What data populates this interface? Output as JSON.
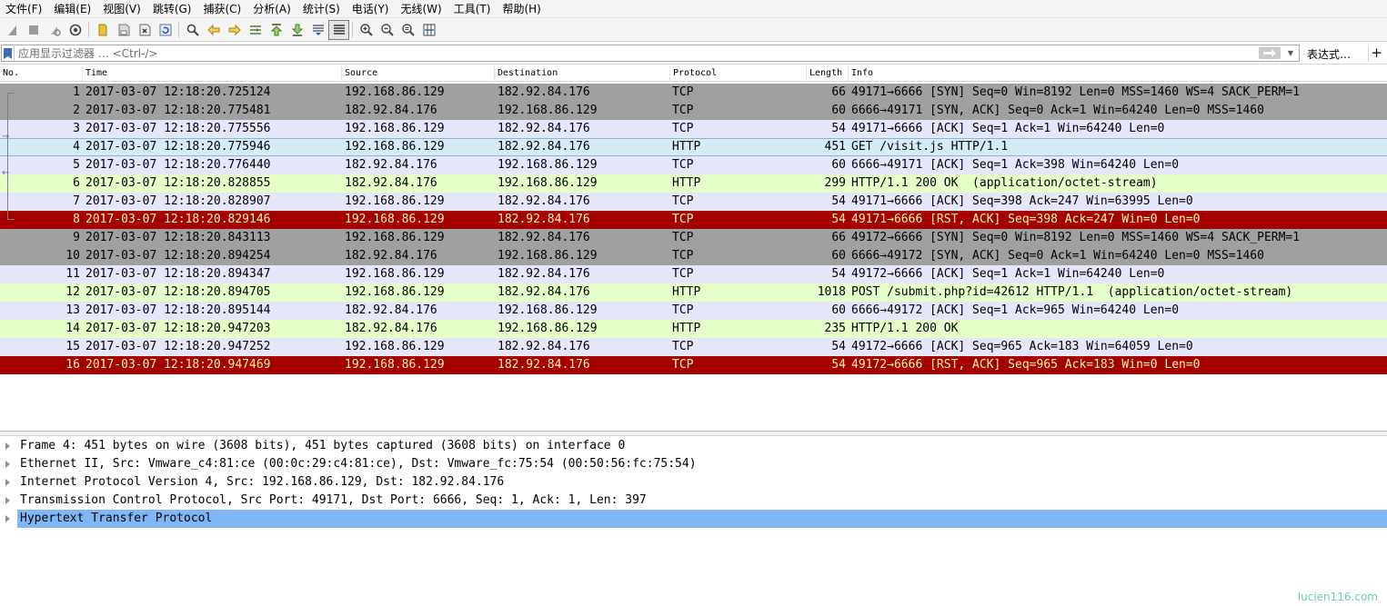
{
  "menu": [
    "文件(F)",
    "编辑(E)",
    "视图(V)",
    "跳转(G)",
    "捕获(C)",
    "分析(A)",
    "统计(S)",
    "电话(Y)",
    "无线(W)",
    "工具(T)",
    "帮助(H)"
  ],
  "toolbar": {
    "icons": [
      "shark-fin-start-icon",
      "stop-icon",
      "restart-icon",
      "capture-options-icon",
      "open-file-icon",
      "save-file-icon",
      "close-file-icon",
      "reload-icon",
      "find-packet-icon",
      "go-back-icon",
      "go-forward-icon",
      "go-to-packet-icon",
      "go-first-icon",
      "go-last-icon",
      "auto-scroll-icon",
      "colorize-icon",
      "zoom-in-icon",
      "zoom-out-icon",
      "zoom-normal-icon",
      "resize-columns-icon"
    ]
  },
  "filter": {
    "placeholder": "应用显示过滤器 … <Ctrl-/>",
    "expression_label": "表达式…",
    "add_label": "+"
  },
  "columns": {
    "no": "No.",
    "time": "Time",
    "source": "Source",
    "destination": "Destination",
    "protocol": "Protocol",
    "length": "Length",
    "info": "Info"
  },
  "packets": [
    {
      "no": "1",
      "time": "2017-03-07 12:18:20.725124",
      "src": "192.168.86.129",
      "dst": "182.92.84.176",
      "proto": "TCP",
      "len": "66",
      "info": "49171→6666 [SYN] Seq=0 Win=8192 Len=0 MSS=1460 WS=4 SACK_PERM=1",
      "style": "gray"
    },
    {
      "no": "2",
      "time": "2017-03-07 12:18:20.775481",
      "src": "182.92.84.176",
      "dst": "192.168.86.129",
      "proto": "TCP",
      "len": "60",
      "info": "6666→49171 [SYN, ACK] Seq=0 Ack=1 Win=64240 Len=0 MSS=1460",
      "style": "gray"
    },
    {
      "no": "3",
      "time": "2017-03-07 12:18:20.775556",
      "src": "192.168.86.129",
      "dst": "182.92.84.176",
      "proto": "TCP",
      "len": "54",
      "info": "49171→6666 [ACK] Seq=1 Ack=1 Win=64240 Len=0",
      "style": "tcp"
    },
    {
      "no": "4",
      "time": "2017-03-07 12:18:20.775946",
      "src": "192.168.86.129",
      "dst": "182.92.84.176",
      "proto": "HTTP",
      "len": "451",
      "info": "GET /visit.js HTTP/1.1",
      "style": "selected"
    },
    {
      "no": "5",
      "time": "2017-03-07 12:18:20.776440",
      "src": "182.92.84.176",
      "dst": "192.168.86.129",
      "proto": "TCP",
      "len": "60",
      "info": "6666→49171 [ACK] Seq=1 Ack=398 Win=64240 Len=0",
      "style": "tcp"
    },
    {
      "no": "6",
      "time": "2017-03-07 12:18:20.828855",
      "src": "182.92.84.176",
      "dst": "192.168.86.129",
      "proto": "HTTP",
      "len": "299",
      "info": "HTTP/1.1 200 OK  (application/octet-stream)",
      "style": "http"
    },
    {
      "no": "7",
      "time": "2017-03-07 12:18:20.828907",
      "src": "192.168.86.129",
      "dst": "182.92.84.176",
      "proto": "TCP",
      "len": "54",
      "info": "49171→6666 [ACK] Seq=398 Ack=247 Win=63995 Len=0",
      "style": "tcp"
    },
    {
      "no": "8",
      "time": "2017-03-07 12:18:20.829146",
      "src": "192.168.86.129",
      "dst": "182.92.84.176",
      "proto": "TCP",
      "len": "54",
      "info": "49171→6666 [RST, ACK] Seq=398 Ack=247 Win=0 Len=0",
      "style": "rst"
    },
    {
      "no": "9",
      "time": "2017-03-07 12:18:20.843113",
      "src": "192.168.86.129",
      "dst": "182.92.84.176",
      "proto": "TCP",
      "len": "66",
      "info": "49172→6666 [SYN] Seq=0 Win=8192 Len=0 MSS=1460 WS=4 SACK_PERM=1",
      "style": "gray"
    },
    {
      "no": "10",
      "time": "2017-03-07 12:18:20.894254",
      "src": "182.92.84.176",
      "dst": "192.168.86.129",
      "proto": "TCP",
      "len": "60",
      "info": "6666→49172 [SYN, ACK] Seq=0 Ack=1 Win=64240 Len=0 MSS=1460",
      "style": "gray"
    },
    {
      "no": "11",
      "time": "2017-03-07 12:18:20.894347",
      "src": "192.168.86.129",
      "dst": "182.92.84.176",
      "proto": "TCP",
      "len": "54",
      "info": "49172→6666 [ACK] Seq=1 Ack=1 Win=64240 Len=0",
      "style": "tcp"
    },
    {
      "no": "12",
      "time": "2017-03-07 12:18:20.894705",
      "src": "192.168.86.129",
      "dst": "182.92.84.176",
      "proto": "HTTP",
      "len": "1018",
      "info": "POST /submit.php?id=42612 HTTP/1.1  (application/octet-stream)",
      "style": "http"
    },
    {
      "no": "13",
      "time": "2017-03-07 12:18:20.895144",
      "src": "182.92.84.176",
      "dst": "192.168.86.129",
      "proto": "TCP",
      "len": "60",
      "info": "6666→49172 [ACK] Seq=1 Ack=965 Win=64240 Len=0",
      "style": "tcp"
    },
    {
      "no": "14",
      "time": "2017-03-07 12:18:20.947203",
      "src": "182.92.84.176",
      "dst": "192.168.86.129",
      "proto": "HTTP",
      "len": "235",
      "info": "HTTP/1.1 200 OK",
      "style": "http"
    },
    {
      "no": "15",
      "time": "2017-03-07 12:18:20.947252",
      "src": "192.168.86.129",
      "dst": "182.92.84.176",
      "proto": "TCP",
      "len": "54",
      "info": "49172→6666 [ACK] Seq=965 Ack=183 Win=64059 Len=0",
      "style": "tcp"
    },
    {
      "no": "16",
      "time": "2017-03-07 12:18:20.947469",
      "src": "192.168.86.129",
      "dst": "182.92.84.176",
      "proto": "TCP",
      "len": "54",
      "info": "49172→6666 [RST, ACK] Seq=965 Ack=183 Win=0 Len=0",
      "style": "rst"
    }
  ],
  "details": [
    {
      "text": "Frame 4: 451 bytes on wire (3608 bits), 451 bytes captured (3608 bits) on interface 0",
      "selected": false
    },
    {
      "text": "Ethernet II, Src: Vmware_c4:81:ce (00:0c:29:c4:81:ce), Dst: Vmware_fc:75:54 (00:50:56:fc:75:54)",
      "selected": false
    },
    {
      "text": "Internet Protocol Version 4, Src: 192.168.86.129, Dst: 182.92.84.176",
      "selected": false
    },
    {
      "text": "Transmission Control Protocol, Src Port: 49171, Dst Port: 6666, Seq: 1, Ack: 1, Len: 397",
      "selected": false
    },
    {
      "text": "Hypertext Transfer Protocol",
      "selected": true
    }
  ],
  "watermark": "lucien116.com",
  "colors": {
    "handshake_gray": "#a0a0a0",
    "tcp": "#e6e6fa",
    "http": "#e4ffc7",
    "rst_bg": "#a40000",
    "rst_fg": "#fffc9c",
    "selected_packet": "#d7ebf5",
    "selected_detail": "#7fb6f6"
  }
}
